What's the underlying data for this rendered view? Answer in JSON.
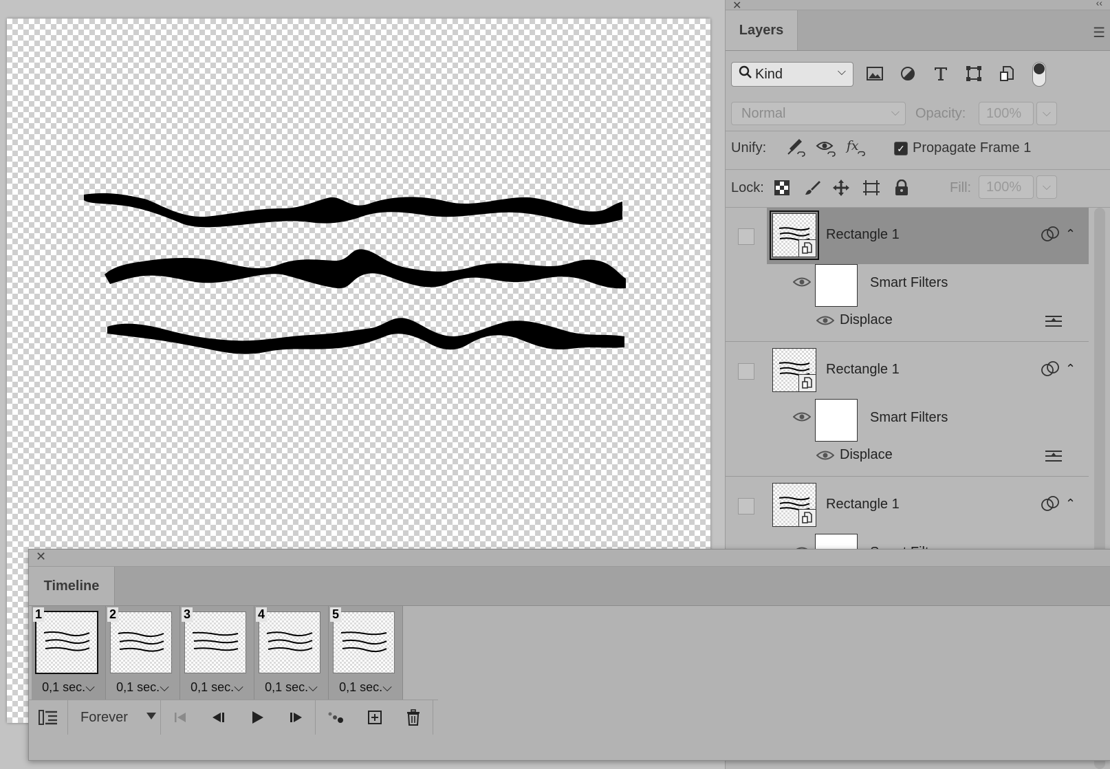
{
  "canvas": {
    "background": "transparent-checker",
    "content": "three torn black wavy strokes"
  },
  "layers_panel": {
    "tab_label": "Layers",
    "kind_filter": {
      "label": "Kind",
      "icon": "search-icon"
    },
    "filter_icons": [
      "image-icon",
      "adjustment-icon",
      "type-icon",
      "shape-icon",
      "smart-object-icon"
    ],
    "blend_mode": "Normal",
    "opacity_label": "Opacity:",
    "opacity_value": "100%",
    "unify_label": "Unify:",
    "propagate_label": "Propagate Frame 1",
    "propagate_checked": true,
    "lock_label": "Lock:",
    "fill_label": "Fill:",
    "fill_value": "100%",
    "layers": [
      {
        "name": "Rectangle 1",
        "selected": true,
        "smart_filters": "Smart Filters",
        "filter": "Displace"
      },
      {
        "name": "Rectangle 1",
        "selected": false,
        "smart_filters": "Smart Filters",
        "filter": "Displace"
      },
      {
        "name": "Rectangle 1",
        "selected": false,
        "smart_filters": "Smart Filters",
        "filter": ""
      }
    ]
  },
  "timeline": {
    "tab_label": "Timeline",
    "frames": [
      {
        "num": "1",
        "delay": "0,1 sec.",
        "selected": true
      },
      {
        "num": "2",
        "delay": "0,1 sec.",
        "selected": false
      },
      {
        "num": "3",
        "delay": "0,1 sec.",
        "selected": false
      },
      {
        "num": "4",
        "delay": "0,1 sec.",
        "selected": false
      },
      {
        "num": "5",
        "delay": "0,1 sec.",
        "selected": false
      }
    ],
    "loop": "Forever"
  },
  "colors": {
    "panel_bg": "#b8b8b8",
    "selected_layer": "#8f8f8f",
    "canvas_stroke": "#000000"
  }
}
